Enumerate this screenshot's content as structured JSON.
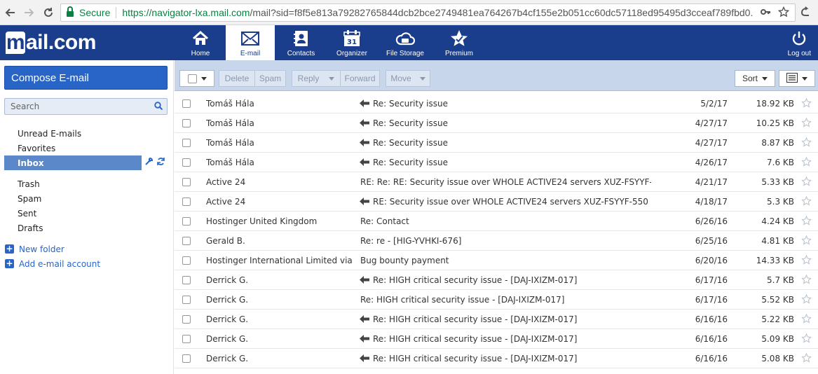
{
  "browser": {
    "secure_label": "Secure",
    "url_host": "https://navigator-lxa.mail.com",
    "url_rest": "/mail?sid=f8f5e813a79282765844dcb2bce2749481ea764267b4cf155e2b051cc60dc57118ed95495d3cceaf789fbd0..."
  },
  "header": {
    "logo_m": "m",
    "logo_text": "ail.com",
    "nav": [
      {
        "label": "Home",
        "icon": "home-icon"
      },
      {
        "label": "E-mail",
        "icon": "envelope-icon"
      },
      {
        "label": "Contacts",
        "icon": "contacts-icon"
      },
      {
        "label": "Organizer",
        "icon": "calendar-icon"
      },
      {
        "label": "File Storage",
        "icon": "cloud-icon"
      },
      {
        "label": "Premium",
        "icon": "star-icon"
      }
    ],
    "calendar_day": "31",
    "logout_label": "Log out"
  },
  "sidebar": {
    "compose_label": "Compose E-mail",
    "search_placeholder": "Search",
    "folders_top": [
      "Unread E-mails",
      "Favorites"
    ],
    "inbox_label": "Inbox",
    "folders_bottom": [
      "Trash",
      "Spam",
      "Sent",
      "Drafts"
    ],
    "add_folder": "New folder",
    "add_account": "Add e-mail account"
  },
  "toolbar": {
    "delete": "Delete",
    "spam": "Spam",
    "reply": "Reply",
    "forward": "Forward",
    "move": "Move",
    "sort": "Sort"
  },
  "emails": [
    {
      "from": "Tomáš Hála",
      "subject": "Re: Security issue",
      "replied": true,
      "date": "5/2/17",
      "size": "18.92 KB"
    },
    {
      "from": "Tomáš Hála",
      "subject": "Re: Security issue",
      "replied": true,
      "date": "4/27/17",
      "size": "10.25 KB"
    },
    {
      "from": "Tomáš Hála",
      "subject": "Re: Security issue",
      "replied": true,
      "date": "4/27/17",
      "size": "8.87 KB"
    },
    {
      "from": "Tomáš Hála",
      "subject": "Re: Security issue",
      "replied": true,
      "date": "4/26/17",
      "size": "7.6 KB"
    },
    {
      "from": "Active 24",
      "subject": "RE: Re: RE: Security issue over WHOLE ACTIVE24 servers XUZ-FSYYF-5...",
      "replied": false,
      "date": "4/21/17",
      "size": "5.33 KB"
    },
    {
      "from": "Active 24",
      "subject": "RE: Security issue over WHOLE ACTIVE24 servers XUZ-FSYYF-550",
      "replied": true,
      "date": "4/18/17",
      "size": "5.3 KB"
    },
    {
      "from": "Hostinger United Kingdom",
      "subject": "Re: Contact",
      "replied": false,
      "date": "6/26/16",
      "size": "4.24 KB"
    },
    {
      "from": "Gerald B.",
      "subject": "Re: re - [HIG-YVHKI-676]",
      "replied": false,
      "date": "6/25/16",
      "size": "4.81 KB"
    },
    {
      "from": "Hostinger International Limited via ...",
      "subject": "Bug bounty payment",
      "replied": false,
      "date": "6/20/16",
      "size": "14.33 KB"
    },
    {
      "from": "Derrick G.",
      "subject": "Re: HIGH critical security issue - [DAJ-IXIZM-017]",
      "replied": true,
      "date": "6/17/16",
      "size": "5.7 KB"
    },
    {
      "from": "Derrick G.",
      "subject": "Re: HIGH critical security issue - [DAJ-IXIZM-017]",
      "replied": false,
      "date": "6/17/16",
      "size": "5.52 KB"
    },
    {
      "from": "Derrick G.",
      "subject": "Re: HIGH critical security issue - [DAJ-IXIZM-017]",
      "replied": true,
      "date": "6/16/16",
      "size": "5.22 KB"
    },
    {
      "from": "Derrick G.",
      "subject": "Re: HIGH critical security issue - [DAJ-IXIZM-017]",
      "replied": true,
      "date": "6/16/16",
      "size": "5.09 KB"
    },
    {
      "from": "Derrick G.",
      "subject": "Re: HIGH critical security issue - [DAJ-IXIZM-017]",
      "replied": true,
      "date": "6/16/16",
      "size": "5.08 KB"
    }
  ],
  "colors": {
    "brand_blue": "#1b3e8c",
    "accent_blue": "#2965c7",
    "secure_green": "#0b8043"
  }
}
